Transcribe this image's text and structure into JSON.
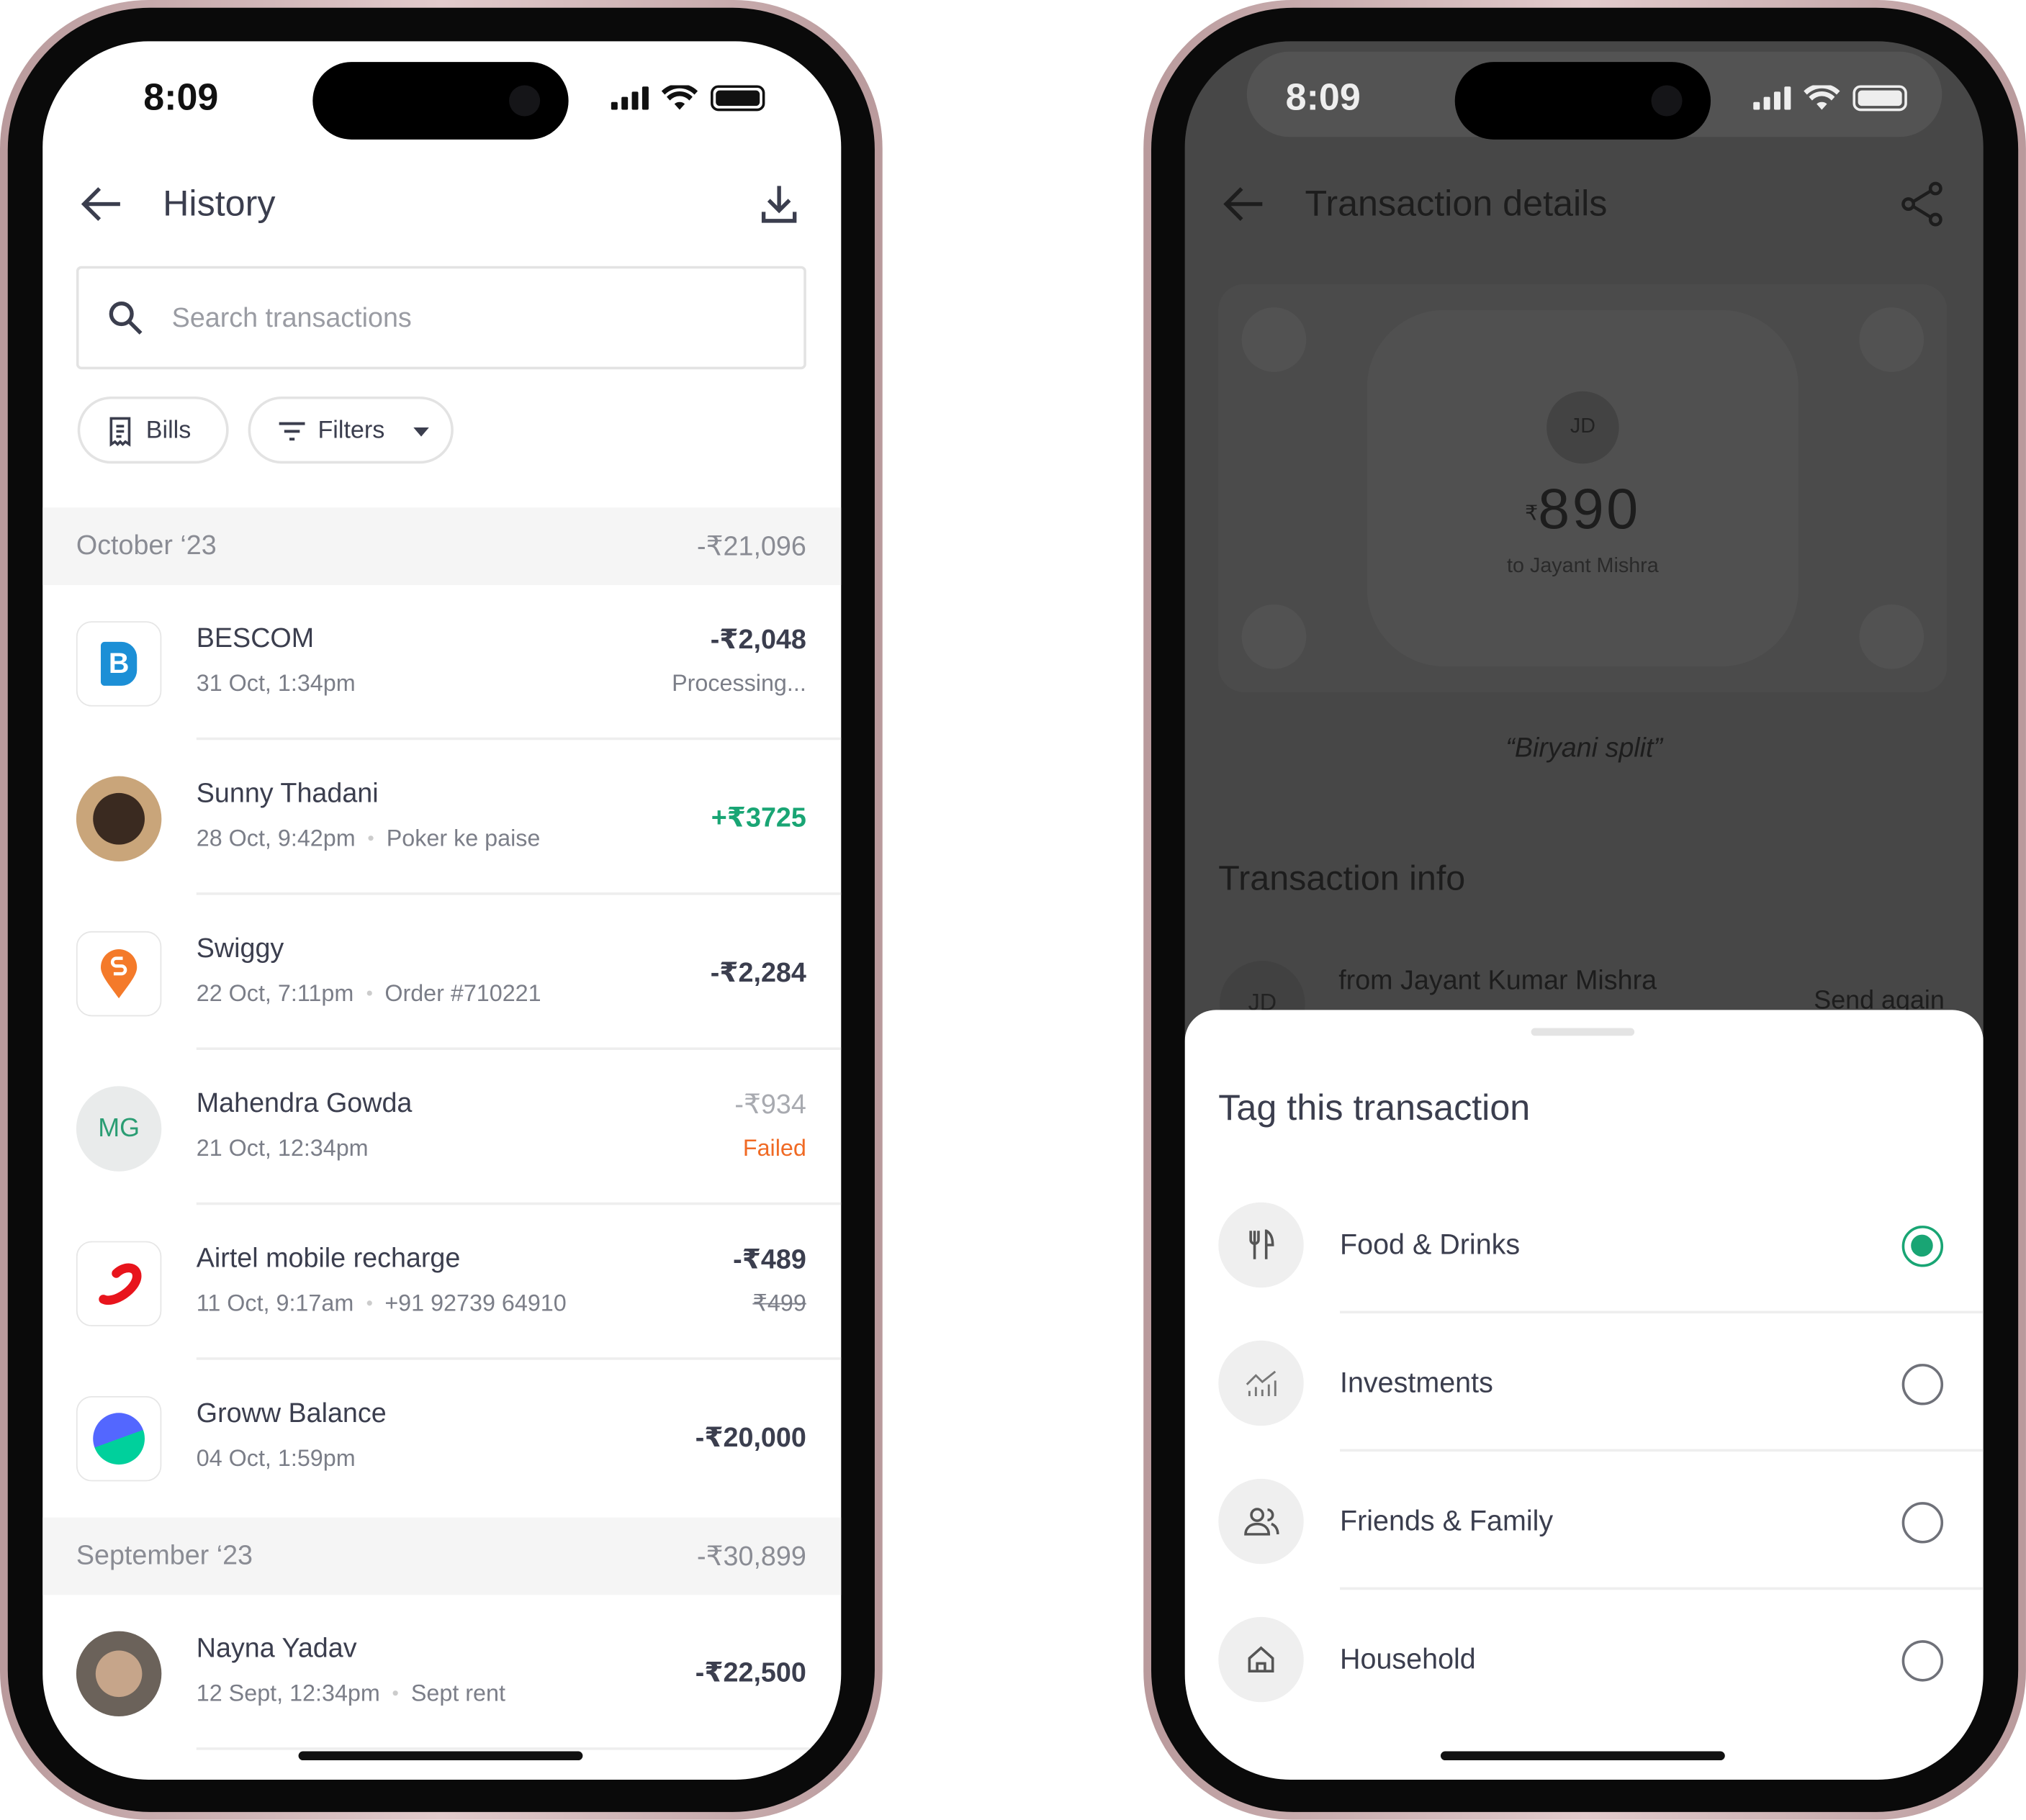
{
  "status": {
    "time": "8:09"
  },
  "history": {
    "title": "History",
    "search_placeholder": "Search transactions",
    "chips": {
      "bills": "Bills",
      "filters": "Filters"
    },
    "groups": [
      {
        "month": "October ‘23",
        "total": "-₹21,096",
        "items": [
          {
            "name": "BESCOM",
            "date": "31 Oct, 1:34pm",
            "note": "",
            "amount": "-₹2,048",
            "status": "Processing..."
          },
          {
            "name": "Sunny Thadani",
            "date": "28 Oct, 9:42pm",
            "note": "Poker ke paise",
            "amount": "+₹3725",
            "status": ""
          },
          {
            "name": "Swiggy",
            "date": "22 Oct, 7:11pm",
            "note": "Order #710221",
            "amount": "-₹2,284",
            "status": ""
          },
          {
            "name": "Mahendra Gowda",
            "initials": "MG",
            "date": "21 Oct, 12:34pm",
            "note": "",
            "amount": "-₹934",
            "status": "Failed"
          },
          {
            "name": "Airtel mobile recharge",
            "date": "11 Oct, 9:17am",
            "note": "+91 92739 64910",
            "amount": "-₹489",
            "status": "₹499"
          },
          {
            "name": "Groww Balance",
            "date": "04 Oct, 1:59pm",
            "note": "",
            "amount": "-₹20,000",
            "status": ""
          }
        ]
      },
      {
        "month": "September ‘23",
        "total": "-₹30,899",
        "items": [
          {
            "name": "Nayna Yadav",
            "date": "12 Sept, 12:34pm",
            "note": "Sept rent",
            "amount": "-₹22,500",
            "status": ""
          }
        ]
      }
    ]
  },
  "details": {
    "title": "Transaction details",
    "initials": "JD",
    "currency": "₹",
    "amount": "890",
    "recipient": "to Jayant Mishra",
    "note": "“Biryani split”",
    "info_title": "Transaction info",
    "from": "from Jayant Kumar Mishra",
    "from_initials": "JD",
    "send_again": "Send again"
  },
  "sheet": {
    "title": "Tag this transaction",
    "options": [
      {
        "label": "Food & Drinks",
        "icon": "fork-knife-icon",
        "selected": true
      },
      {
        "label": "Investments",
        "icon": "chart-icon",
        "selected": false
      },
      {
        "label": "Friends & Family",
        "icon": "people-icon",
        "selected": false
      },
      {
        "label": "Household",
        "icon": "home-icon",
        "selected": false
      }
    ]
  },
  "colors": {
    "positive": "#19a574",
    "failed": "#f06a24",
    "text": "#3b3e4e",
    "selected": "#19a574"
  }
}
